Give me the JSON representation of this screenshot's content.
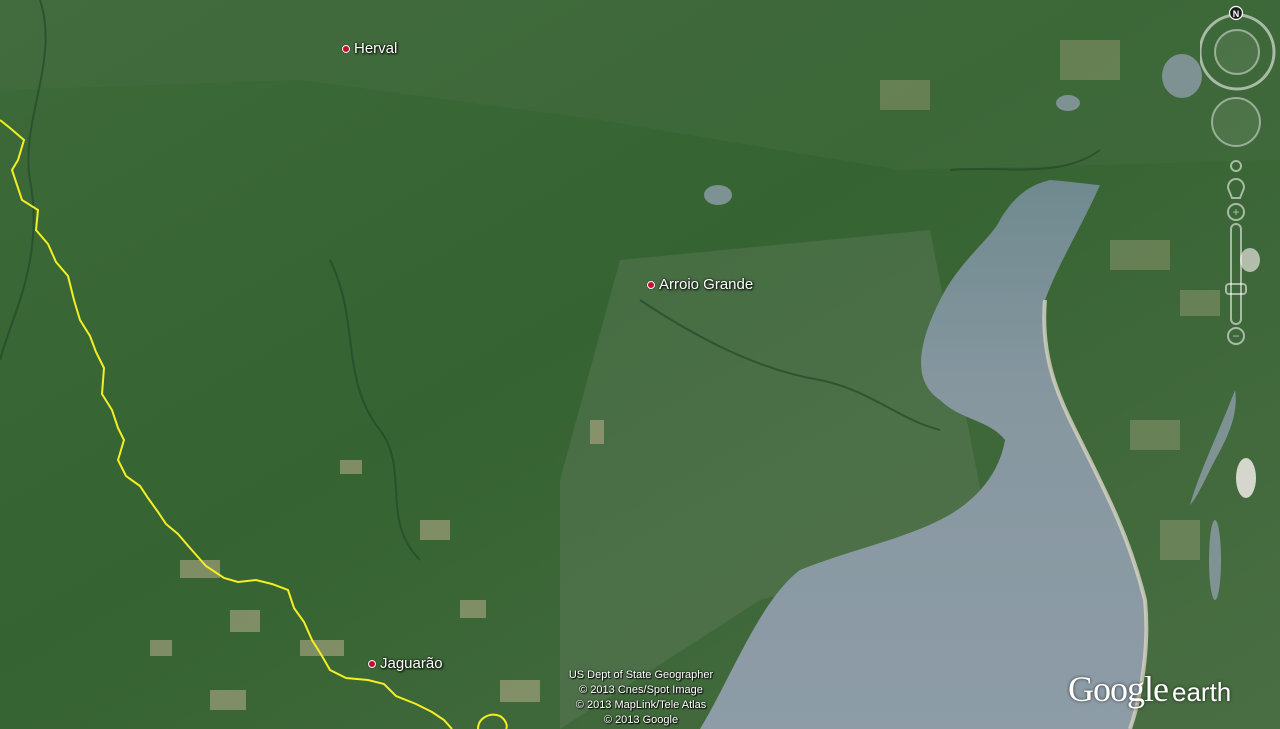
{
  "map": {
    "places": [
      {
        "name": "Herval"
      },
      {
        "name": "Arroio Grande"
      },
      {
        "name": "Jaguarão"
      }
    ],
    "attribution": {
      "lines": [
        "US Dept of State Geographer",
        "© 2013 Cnes/Spot Image",
        "© 2013 MapLink/Tele Atlas",
        "© 2013 Google"
      ]
    },
    "logo": {
      "google": "Google",
      "earth": "earth"
    },
    "compass": {
      "north_label": "N"
    },
    "colors": {
      "land": "#3f6b3a",
      "lake": "#8a9ba3",
      "border": "#f5ee24",
      "place_dot": "#c0102a"
    }
  }
}
